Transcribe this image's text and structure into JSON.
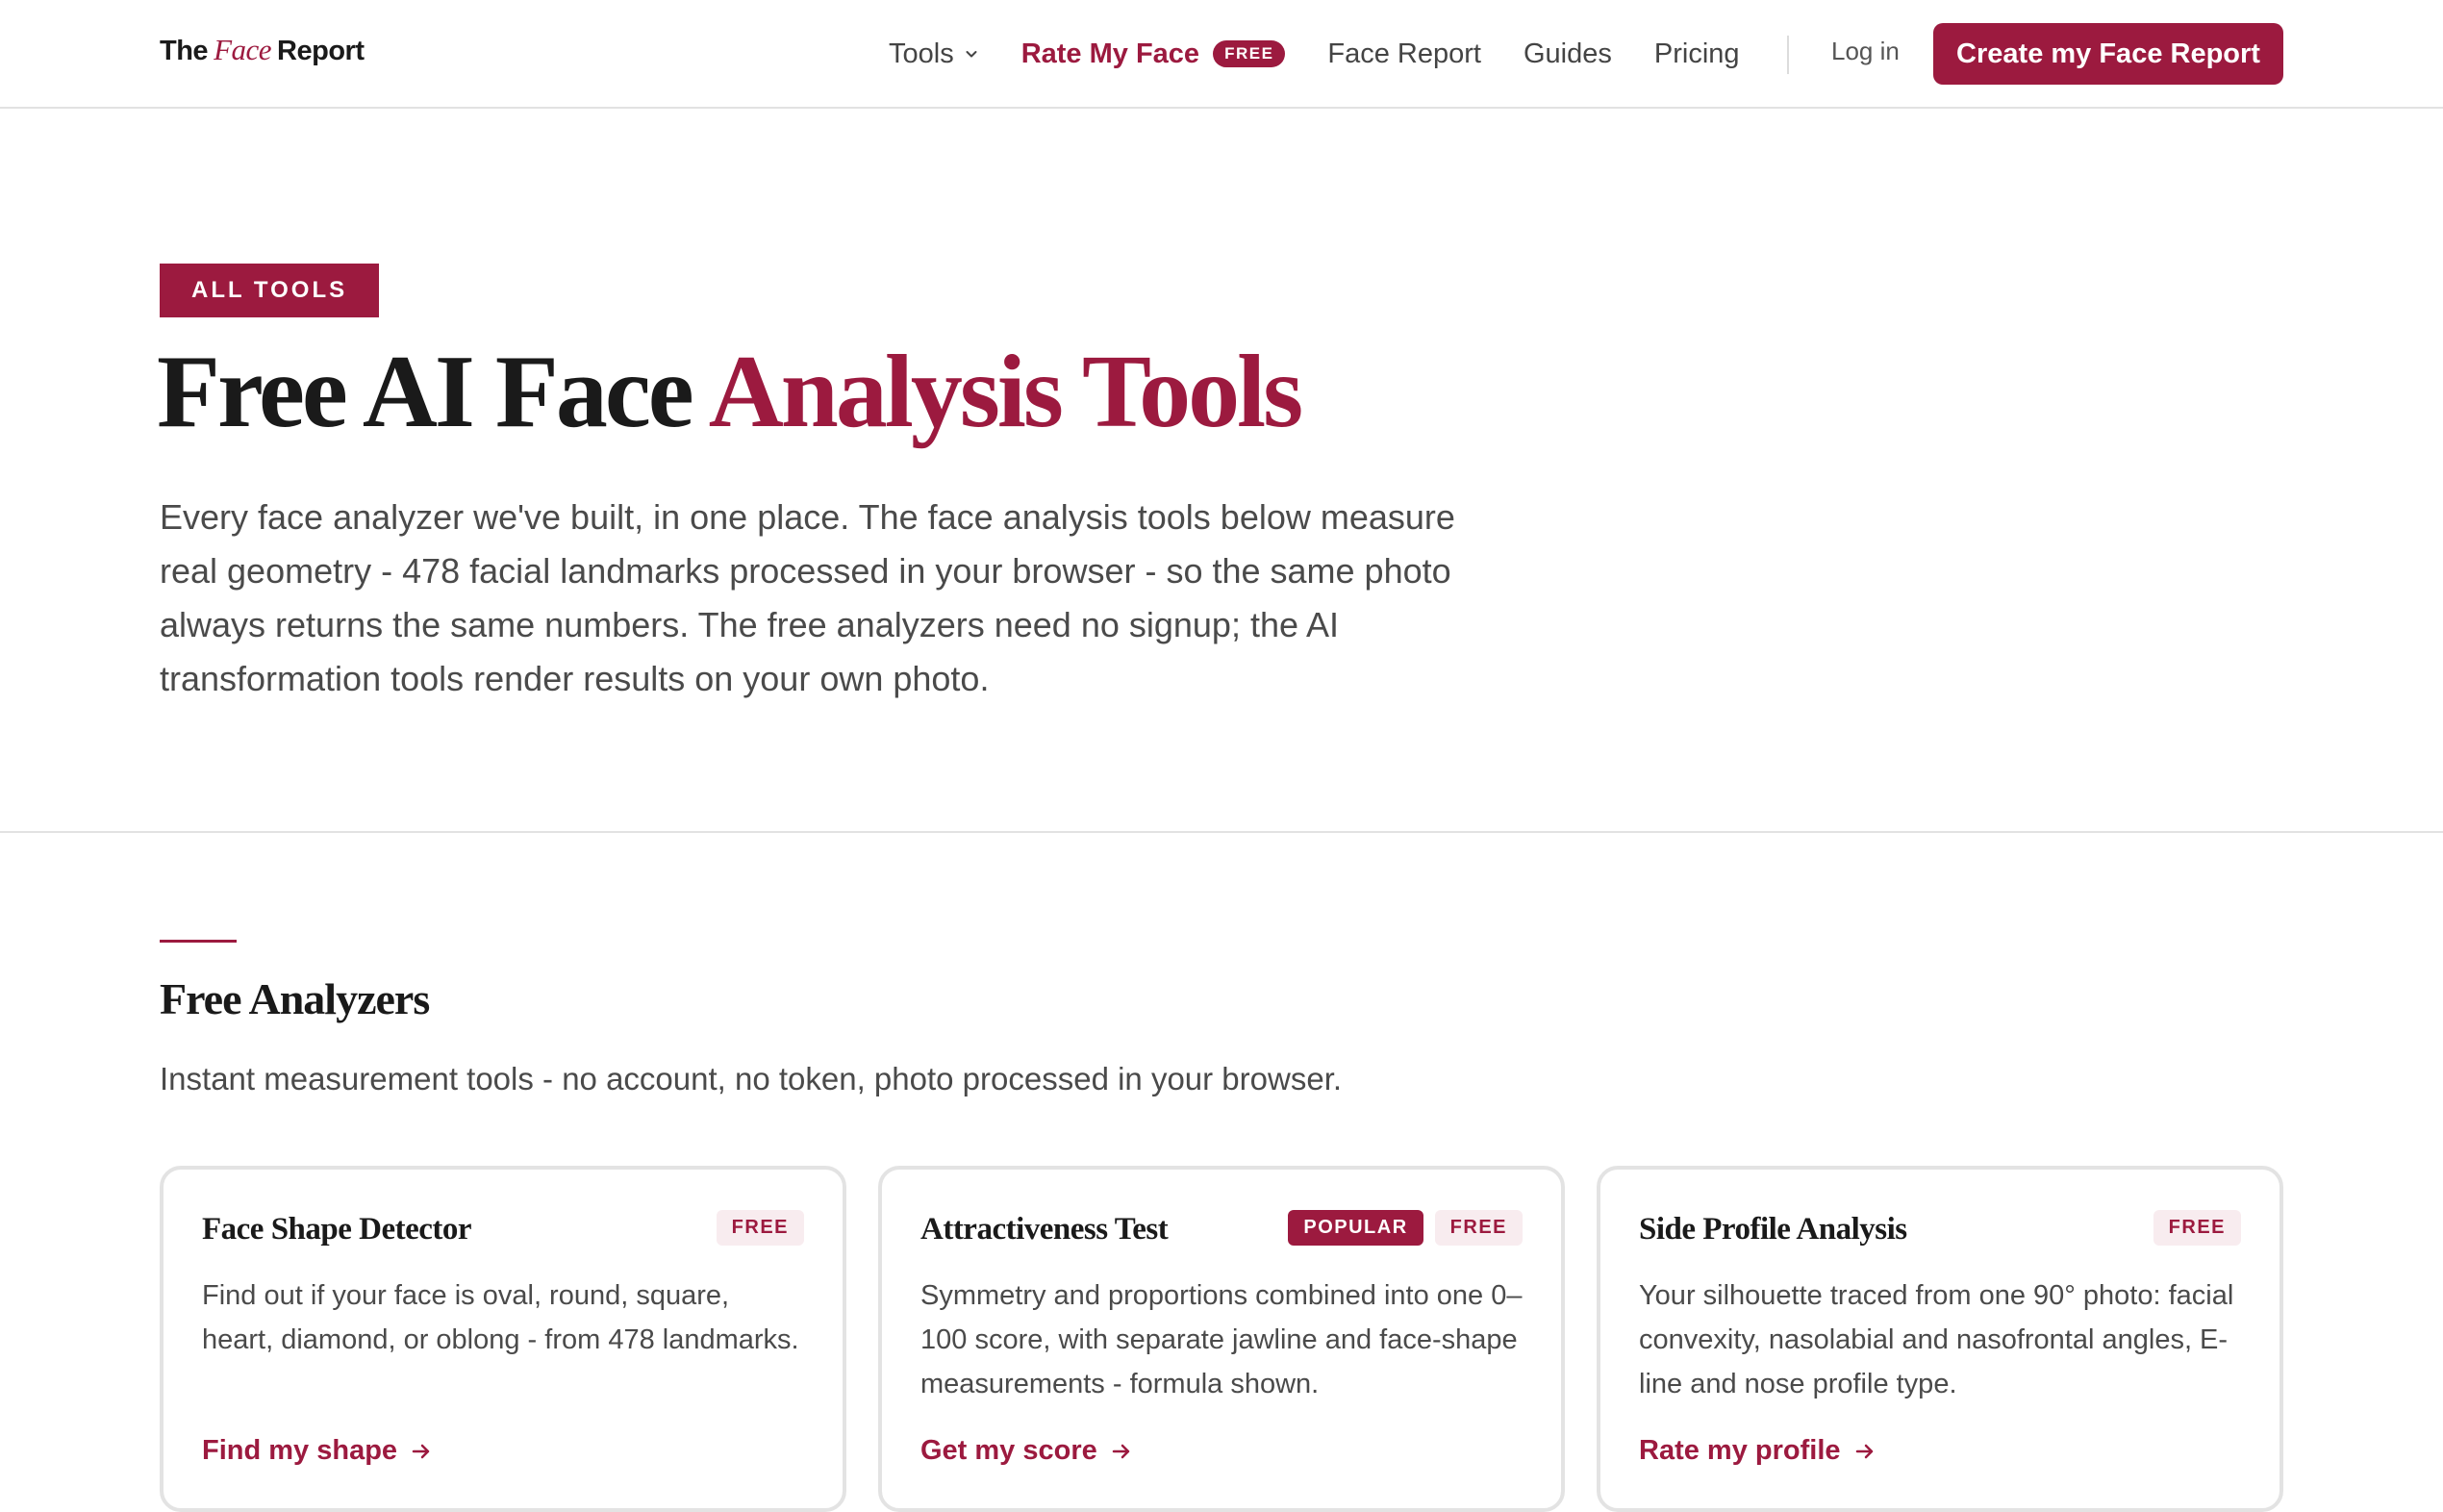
{
  "header": {
    "logo": {
      "the": "The",
      "face": "Face",
      "report": "Report"
    },
    "nav": {
      "tools": "Tools",
      "rate_my_face": "Rate My Face",
      "rate_badge": "FREE",
      "face_report": "Face Report",
      "guides": "Guides",
      "pricing": "Pricing"
    },
    "login": "Log in",
    "cta": "Create my Face Report"
  },
  "hero": {
    "eyebrow": "ALL TOOLS",
    "title_plain": "Free AI Face ",
    "title_accent": "Analysis Tools",
    "description": "Every face analyzer we've built, in one place. The face analysis tools below measure real geometry - 478 facial landmarks processed in your browser - so the same photo always returns the same numbers. The free analyzers need no signup; the AI transformation tools render results on your own photo."
  },
  "section": {
    "title": "Free Analyzers",
    "subtitle": "Instant measurement tools - no account, no token, photo processed in your browser."
  },
  "cards": [
    {
      "title": "Face Shape Detector",
      "badges": [
        "FREE"
      ],
      "description": "Find out if your face is oval, round, square, heart, diamond, or oblong - from 478 landmarks.",
      "link": "Find my shape"
    },
    {
      "title": "Attractiveness Test",
      "badges": [
        "POPULAR",
        "FREE"
      ],
      "description": "Symmetry and proportions combined into one 0–100 score, with separate jawline and face-shape measurements - formula shown.",
      "link": "Get my score"
    },
    {
      "title": "Side Profile Analysis",
      "badges": [
        "FREE"
      ],
      "description": "Your silhouette traced from one 90° photo: facial convexity, nasolabial and nasofrontal angles, E-line and nose profile type.",
      "link": "Rate my profile"
    }
  ],
  "colors": {
    "accent": "#9c1a3f",
    "text": "#1a1a1a",
    "muted": "#4a4a4a",
    "border": "#e3e3e3",
    "badge_bg": "#f8ecef"
  },
  "icons": {
    "tools_dropdown": "chevron-down-icon",
    "card_link": "arrow-right-icon"
  }
}
